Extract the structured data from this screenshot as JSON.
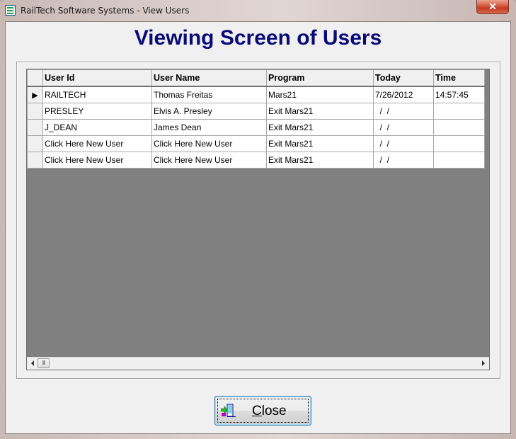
{
  "window": {
    "title": "RailTech Software Systems - View Users",
    "close_glyph": "✕"
  },
  "heading": "Viewing Screen of Users",
  "grid": {
    "columns": [
      "User Id",
      "User Name",
      "Program",
      "Today",
      "Time"
    ],
    "current_row_marker": "▶",
    "rows": [
      {
        "user_id": "RAILTECH",
        "user_name": "Thomas Freitas",
        "program": "Mars21",
        "today": "7/26/2012",
        "time": "14:57:45",
        "current": true
      },
      {
        "user_id": "PRESLEY",
        "user_name": "Elvis A. Presley",
        "program": "Exit Mars21",
        "today": "  /  /",
        "time": "",
        "current": false
      },
      {
        "user_id": "J_DEAN",
        "user_name": "James Dean",
        "program": "Exit Mars21",
        "today": "  /  /",
        "time": "",
        "current": false
      },
      {
        "user_id": "Click Here New User",
        "user_name": "Click Here New User",
        "program": "Exit Mars21",
        "today": "  /  /",
        "time": "",
        "current": false
      },
      {
        "user_id": "Click Here New User",
        "user_name": "Click Here New User",
        "program": "Exit Mars21",
        "today": "  /  /",
        "time": "",
        "current": false
      }
    ],
    "scroll_thumb_glyph": "III"
  },
  "buttons": {
    "close_label_accel": "C",
    "close_label_rest": "lose"
  }
}
